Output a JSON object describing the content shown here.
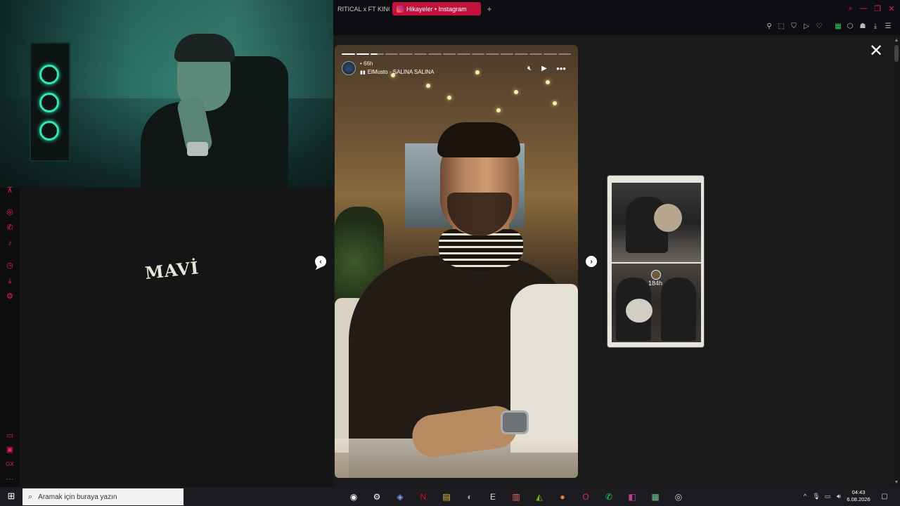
{
  "browser": {
    "tabs": [
      {
        "label": "RITICAL x FT KINGS"
      },
      {
        "label": "Hikayeler • Instagram"
      }
    ],
    "new_tab_label": "+",
    "accent": "#c0123d"
  },
  "story_viewer": {
    "close_label": "✕",
    "progress": {
      "segments": 16,
      "completed": 2,
      "active_index": 2
    },
    "current_story": {
      "time": "66h",
      "music": "ElMusto · SALINA SALINA",
      "jacket_text": "MAVİ"
    },
    "prev_label": "‹",
    "next_label": "›",
    "next_story": {
      "time": "184h"
    }
  },
  "taskbar": {
    "search_placeholder": "Aramak için buraya yazın",
    "clock_time": "04:43",
    "clock_date": "6.08.2026"
  },
  "icons": {
    "sidebar": [
      "twitch-icon",
      "instagram-icon",
      "whatsapp-icon",
      "tiktok-icon",
      "history-icon",
      "download-icon",
      "settings-icon",
      "wallet-icon",
      "box-icon",
      "gx-icon",
      "more-icon"
    ],
    "taskbar_apps": [
      "cortana-icon",
      "settings-icon",
      "discord-icon",
      "netflix-icon",
      "file-explorer-icon",
      "steam-icon",
      "epic-games-icon",
      "office-icon",
      "nvidia-icon",
      "app-orange-icon",
      "opera-icon",
      "whatsapp-icon",
      "media-icon",
      "notepad-icon",
      "obs-icon"
    ]
  }
}
